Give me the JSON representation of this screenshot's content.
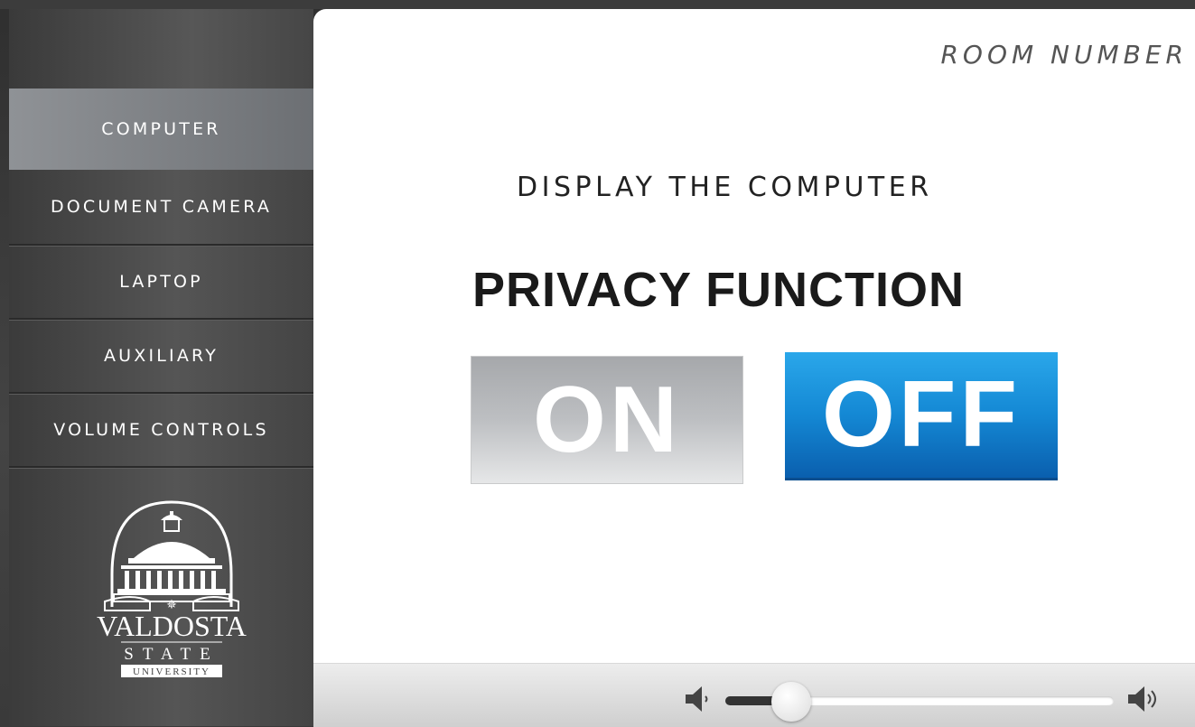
{
  "sidebar": {
    "items": [
      {
        "label": "COMPUTER",
        "active": true
      },
      {
        "label": "DOCUMENT CAMERA",
        "active": false
      },
      {
        "label": "LAPTOP",
        "active": false
      },
      {
        "label": "AUXILIARY",
        "active": false
      },
      {
        "label": "VOLUME CONTROLS",
        "active": false
      }
    ],
    "logo": {
      "name": "VALDOSTA",
      "line2": "STATE",
      "line3": "UNIVERSITY"
    }
  },
  "main": {
    "room_number": "ROOM NUMBER",
    "subtitle": "DISPLAY THE COMPUTER",
    "heading": "PRIVACY FUNCTION",
    "on_label": "ON",
    "off_label": "OFF",
    "on_selected": false,
    "off_selected": true
  },
  "volume": {
    "level": 0.17
  },
  "colors": {
    "accent_blue": "#1488d4",
    "off_gray": "#bdbfc2",
    "sidebar_active": "#7b7e82"
  }
}
